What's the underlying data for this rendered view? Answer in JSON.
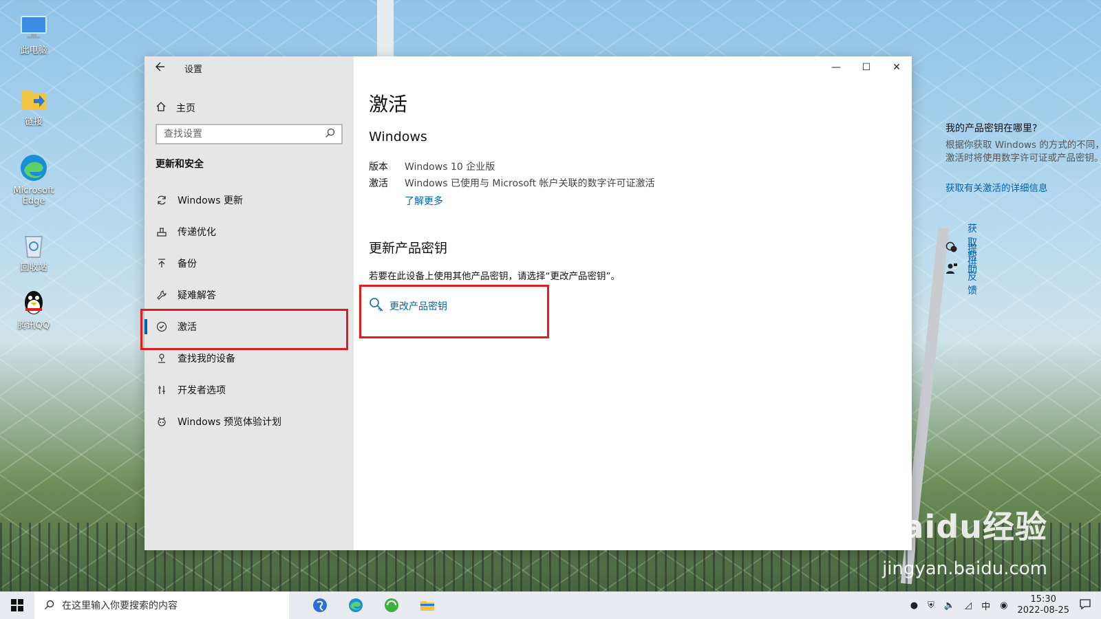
{
  "desktop": {
    "icons": [
      {
        "label": "此电脑",
        "icon": "computer-icon"
      },
      {
        "label": "链接",
        "icon": "folder-shortcut-icon"
      },
      {
        "label": "Microsoft Edge",
        "icon": "edge-icon"
      },
      {
        "label": "回收站",
        "icon": "recycle-bin-icon"
      },
      {
        "label": "腾讯QQ",
        "icon": "qq-icon"
      }
    ],
    "watermark": {
      "brand": "Baidu经验",
      "url": "jingyan.baidu.com"
    }
  },
  "window": {
    "title": "设置",
    "controls": {
      "minimize": "—",
      "maximize": "☐",
      "close": "✕"
    }
  },
  "sidebar": {
    "home_label": "主页",
    "search_placeholder": "查找设置",
    "section_header": "更新和安全",
    "items": [
      {
        "label": "Windows 更新",
        "icon": "sync-icon"
      },
      {
        "label": "传递优化",
        "icon": "delivery-optimization-icon"
      },
      {
        "label": "备份",
        "icon": "backup-icon"
      },
      {
        "label": "疑难解答",
        "icon": "wrench-icon"
      },
      {
        "label": "激活",
        "icon": "check-circle-icon",
        "active": true
      },
      {
        "label": "查找我的设备",
        "icon": "find-device-icon"
      },
      {
        "label": "开发者选项",
        "icon": "developer-icon"
      },
      {
        "label": "Windows 预览体验计划",
        "icon": "insider-icon"
      }
    ]
  },
  "main": {
    "title": "激活",
    "windows_header": "Windows",
    "edition_key": "版本",
    "edition_value": "Windows 10 企业版",
    "activation_key": "激活",
    "activation_value": "Windows 已使用与 Microsoft 帐户关联的数字许可证激活",
    "learn_more": "了解更多",
    "update_key_header": "更新产品密钥",
    "update_key_desc": "若要在此设备上使用其他产品密钥，请选择“更改产品密钥”。",
    "change_key_label": "更改产品密钥"
  },
  "right_panel": {
    "header": "我的产品密钥在哪里?",
    "description": "根据你获取 Windows 的方式的不同，激活时将使用数字许可证或产品密钥。",
    "link": "获取有关激活的详细信息",
    "help_label": "获取帮助",
    "feedback_label": "提供反馈"
  },
  "taskbar": {
    "search_placeholder": "在这里输入你要搜索的内容",
    "time": "15:30",
    "date": "2022-08-25"
  }
}
